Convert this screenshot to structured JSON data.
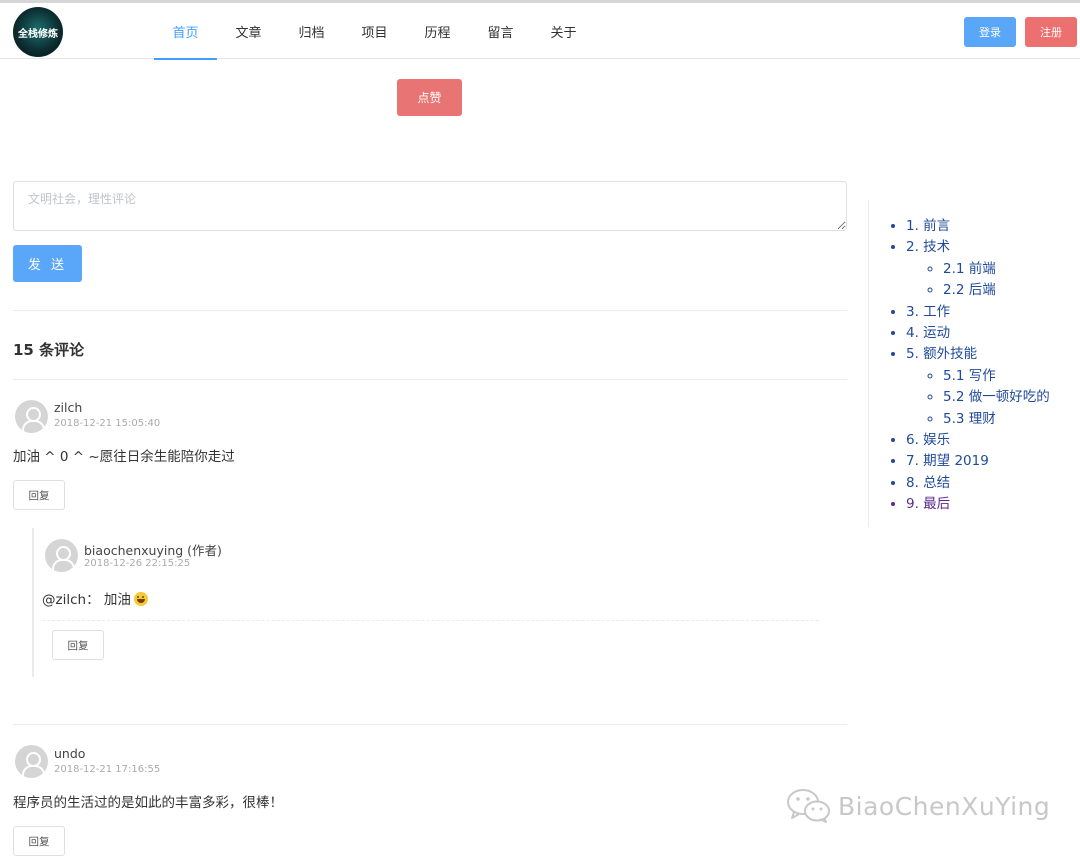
{
  "header": {
    "logo_text": "全栈修炼",
    "nav": [
      {
        "label": "首页",
        "active": true
      },
      {
        "label": "文章",
        "active": false
      },
      {
        "label": "归档",
        "active": false
      },
      {
        "label": "项目",
        "active": false
      },
      {
        "label": "历程",
        "active": false
      },
      {
        "label": "留言",
        "active": false
      },
      {
        "label": "关于",
        "active": false
      }
    ],
    "login_label": "登录",
    "register_label": "注册"
  },
  "article": {
    "like_label": "点赞"
  },
  "comment_form": {
    "placeholder": "文明社会，理性评论",
    "send_label": "发 送"
  },
  "comments_section": {
    "count_title": "15 条评论",
    "comments": [
      {
        "name": "zilch",
        "time": "2018-12-21 15:05:40",
        "text": "加油 ^ 0 ^ ~愿往日余生能陪你走过",
        "reply_label": "回复",
        "replies": [
          {
            "name": "biaochenxuying (作者)",
            "time": "2018-12-26 22:15:25",
            "text": "@zilch： 加油",
            "reply_label": "回复"
          }
        ]
      },
      {
        "name": "undo",
        "time": "2018-12-21 17:16:55",
        "text": "程序员的生活过的是如此的丰富多彩，很棒！",
        "reply_label": "回复"
      }
    ]
  },
  "toc": [
    {
      "label": "1. 前言"
    },
    {
      "label": "2. 技术",
      "children": [
        "2.1 前端",
        "2.2 后端"
      ]
    },
    {
      "label": "3. 工作"
    },
    {
      "label": "4. 运动"
    },
    {
      "label": "5. 额外技能",
      "children": [
        "5.1 写作",
        "5.2 做一顿好吃的",
        "5.3 理财"
      ]
    },
    {
      "label": "6. 娱乐"
    },
    {
      "label": "7. 期望 2019"
    },
    {
      "label": "8. 总结"
    },
    {
      "label": "9. 最后"
    }
  ],
  "watermark": {
    "text": "BiaoChenXuYing",
    "icon": "wechat-icon"
  },
  "colors": {
    "primary": "#409eff",
    "danger": "#ec7070",
    "link": "#1f4a9a",
    "visited": "#5a2a8a"
  }
}
